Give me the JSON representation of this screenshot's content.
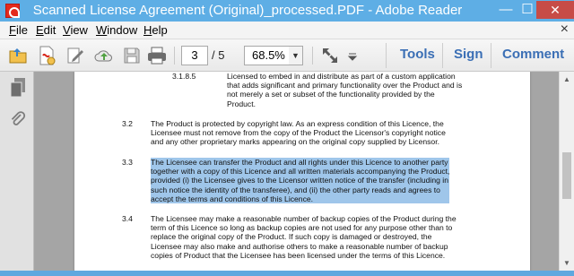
{
  "window": {
    "title": "Scanned License Agreement (Original)_processed.PDF - Adobe Reader",
    "minimize_glyph": "—",
    "maximize_glyph": "☐",
    "close_glyph": "✕"
  },
  "menu": {
    "items": [
      {
        "mnemonic": "F",
        "rest": "ile"
      },
      {
        "mnemonic": "E",
        "rest": "dit"
      },
      {
        "mnemonic": "V",
        "rest": "iew"
      },
      {
        "mnemonic": "W",
        "rest": "indow"
      },
      {
        "mnemonic": "H",
        "rest": "elp"
      }
    ],
    "close_glyph": "×"
  },
  "toolbar": {
    "icons": [
      "open-icon",
      "create-pdf-icon",
      "edit-icon",
      "cloud-upload-icon",
      "save-icon",
      "print-icon",
      "previous-page-icon",
      "next-page-icon",
      "fit-expand-icon",
      "toolbar-dropdown-icon"
    ],
    "page_current": "3",
    "page_total": "/ 5",
    "zoom": "68.5%",
    "zoom_arrow": "▼",
    "tools_label": "Tools",
    "sign_label": "Sign",
    "comment_label": "Comment"
  },
  "sidepanel": {
    "icons": [
      "page-thumbnails-icon",
      "attachments-icon"
    ]
  },
  "document": {
    "paragraphs": [
      {
        "number": "3.1.8.5",
        "lines": [
          "Licensed to embed in and distribute as part of a custom application",
          "that adds significant and primary functionality over the Product and is",
          "not merely a set or subset of the functionality provided by the",
          "Product."
        ]
      },
      {
        "number": "3.2",
        "lines": [
          "The Product is protected by copyright law. As an express condition of this Licence, the",
          "Licensee must not remove from the copy of the Product the Licensor's copyright notice",
          "and any other proprietary marks appearing on the original copy supplied by Licensor."
        ]
      },
      {
        "number": "3.3",
        "highlighted": true,
        "lines": [
          "The Licensee can transfer the Product and all rights under this Licence to another party",
          "together with a copy of this Licence and all written materials accompanying the Product,",
          "provided (i) the Licensee gives to the Licensor written notice of the transfer (including in",
          "such notice the identity of the transferee), and (ii) the other party reads and agrees to",
          "accept the terms and conditions of this Licence."
        ]
      },
      {
        "number": "3.4",
        "lines": [
          "The Licensee may make a reasonable number of backup copies of the Product during the",
          "term of this Licence so long as backup copies are not used for any purpose other than to",
          "replace the original copy of the Product. If such copy is damaged or destroyed, the",
          "Licensee may also make and authorise others to make a reasonable number of backup",
          "copies of Product that the Licensee has been licensed under the terms of this Licence."
        ]
      }
    ]
  },
  "scrollbar": {
    "up_glyph": "▲",
    "down_glyph": "▼"
  },
  "colors": {
    "titlebar": "#5eaee5",
    "close_button": "#c74c47",
    "highlight": "#9fc6ea",
    "link_blue": "#3b6fb5"
  }
}
